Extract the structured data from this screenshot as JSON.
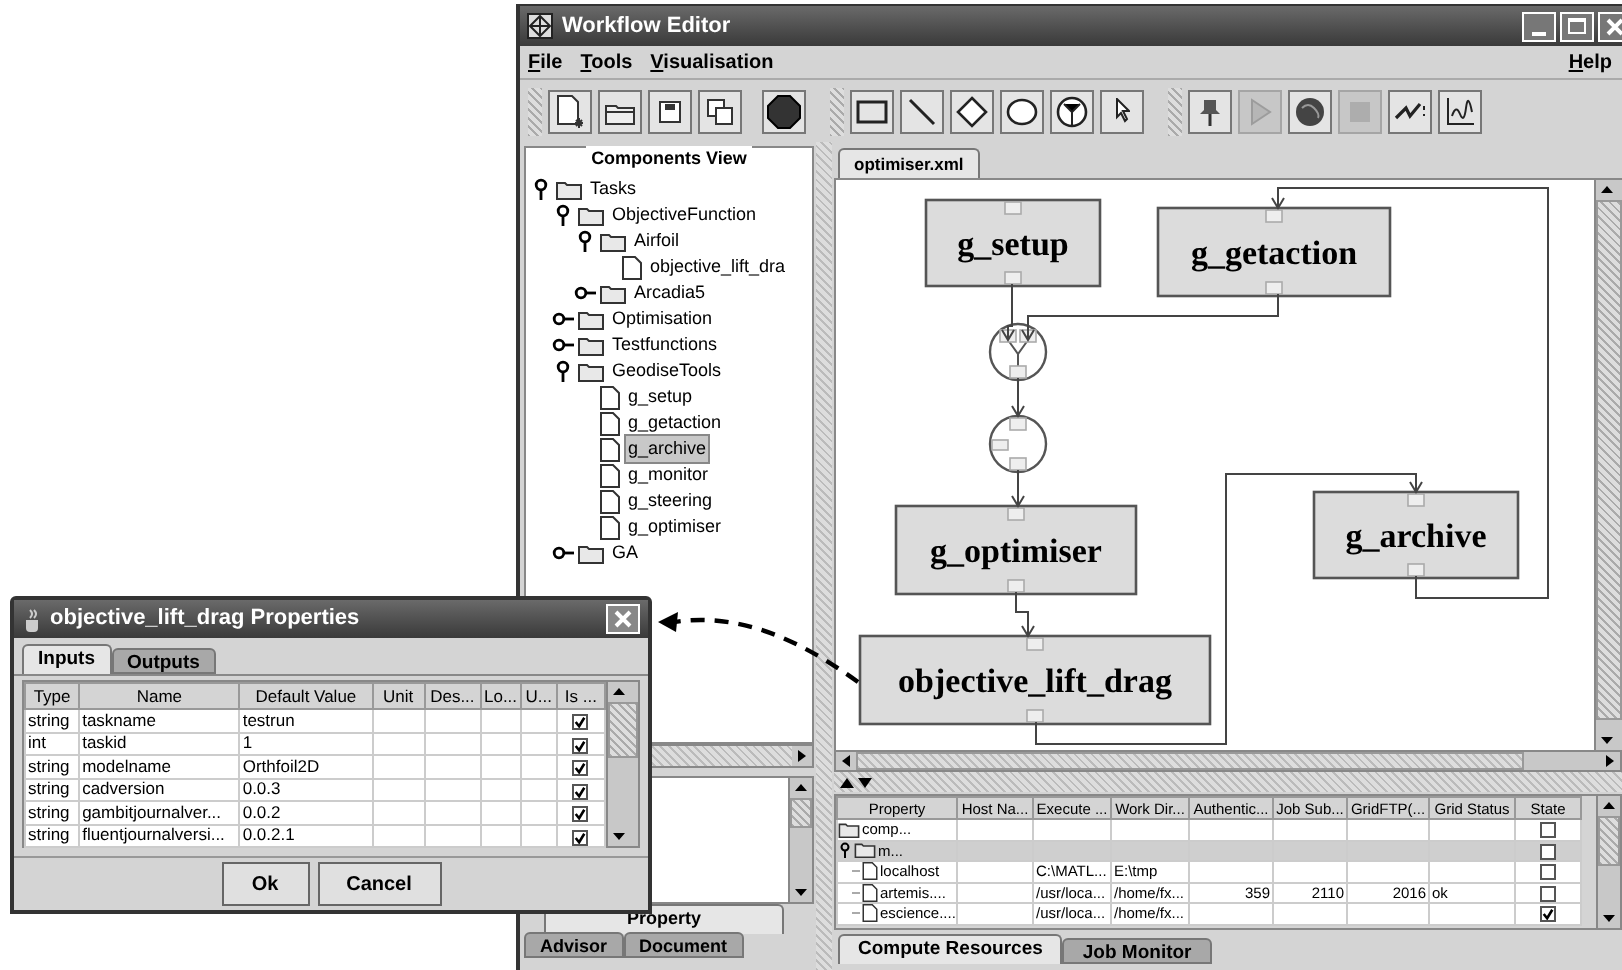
{
  "window": {
    "title": "Workflow Editor"
  },
  "menu": [
    {
      "label": "File"
    },
    {
      "label": "Tools"
    },
    {
      "label": "Visualisation"
    }
  ],
  "help_menu": {
    "label": "Help"
  },
  "toolbar": [
    {
      "disabled": false
    },
    {
      "disabled": false
    },
    {
      "disabled": false
    },
    {
      "disabled": false
    },
    {
      "disabled": false
    },
    {
      "disabled": false
    },
    {
      "disabled": false
    },
    {
      "disabled": false
    },
    {
      "disabled": false
    },
    {
      "disabled": false
    },
    {
      "disabled": false
    },
    {
      "disabled": false
    },
    {
      "disabled": true
    },
    {
      "disabled": false
    },
    {
      "disabled": true
    },
    {
      "disabled": false
    },
    {
      "disabled": false
    }
  ],
  "components_view": {
    "title": "Components View",
    "tree": [
      {
        "label": "Tasks",
        "kind": "folder",
        "expanded": true,
        "selected": false,
        "children": [
          {
            "label": "ObjectiveFunction",
            "kind": "folder",
            "expanded": true,
            "selected": false,
            "children": [
              {
                "label": "Airfoil",
                "kind": "folder",
                "expanded": true,
                "selected": false,
                "children": [
                  {
                    "label": "objective_lift_dra",
                    "kind": "file",
                    "selected": false
                  }
                ]
              },
              {
                "label": "Arcadia5",
                "kind": "folder",
                "expanded": false,
                "selected": false
              }
            ]
          },
          {
            "label": "Optimisation",
            "kind": "folder",
            "expanded": false,
            "selected": false
          },
          {
            "label": "Testfunctions",
            "kind": "folder",
            "expanded": false,
            "selected": false
          },
          {
            "label": "GeodiseTools",
            "kind": "folder",
            "expanded": true,
            "selected": false,
            "children": [
              {
                "label": "g_setup",
                "kind": "file",
                "selected": false
              },
              {
                "label": "g_getaction",
                "kind": "file",
                "selected": false
              },
              {
                "label": "g_archive",
                "kind": "file",
                "selected": true
              },
              {
                "label": "g_monitor",
                "kind": "file",
                "selected": false
              },
              {
                "label": "g_steering",
                "kind": "file",
                "selected": false
              },
              {
                "label": "g_optimiser",
                "kind": "file",
                "selected": false
              }
            ]
          },
          {
            "label": "GA",
            "kind": "folder",
            "expanded": false,
            "selected": false
          }
        ]
      }
    ]
  },
  "left_tabs": [
    {
      "label": "Property",
      "selected": true
    },
    {
      "label": "Advisor",
      "selected": false
    },
    {
      "label": "Document",
      "selected": false
    }
  ],
  "editor_tabs": [
    {
      "label": "optimiser.xml",
      "selected": true
    }
  ],
  "diagram": {
    "nodes": [
      {
        "kind": "task",
        "label": "g_setup"
      },
      {
        "kind": "task",
        "label": "g_getaction"
      },
      {
        "kind": "merge"
      },
      {
        "kind": "junction"
      },
      {
        "kind": "task",
        "label": "g_optimiser"
      },
      {
        "kind": "task",
        "label": "objective_lift_drag"
      },
      {
        "kind": "task",
        "label": "g_archive"
      }
    ]
  },
  "resources": {
    "columns": [
      "Property",
      "Host Na...",
      "Execute ...",
      "Work Dir...",
      "Authentic...",
      "Job Sub...",
      "GridFTP(...",
      "Grid Status",
      "State"
    ],
    "rows": [
      {
        "kind": "folder",
        "expanded": false,
        "selected": false,
        "checked": false,
        "property": "comp..."
      },
      {
        "kind": "folder",
        "expanded": true,
        "selected": true,
        "checked": false,
        "property": "m...",
        "children": [
          {
            "kind": "file",
            "selected": false,
            "checked": false,
            "property": "localhost",
            "execute": "C:\\MATL...",
            "work_dir": "E:\\tmp"
          },
          {
            "kind": "file",
            "selected": false,
            "checked": false,
            "property": "artemis....",
            "execute": "/usr/loca...",
            "work_dir": "/home/fx...",
            "authentication": "359",
            "job_submission": "2110",
            "gridftp": "2016",
            "grid_status": "ok"
          },
          {
            "kind": "file",
            "selected": false,
            "checked": true,
            "property": "escience....",
            "execute": "/usr/loca...",
            "work_dir": "/home/fx..."
          }
        ]
      }
    ]
  },
  "bottom_tabs": [
    {
      "label": "Compute Resources",
      "selected": true
    },
    {
      "label": "Job Monitor",
      "selected": false
    }
  ],
  "dialog": {
    "title": "objective_lift_drag Properties",
    "tabs": [
      {
        "label": "Inputs",
        "selected": true
      },
      {
        "label": "Outputs",
        "selected": false
      }
    ],
    "columns": [
      "Type",
      "Name",
      "Default Value",
      "Unit",
      "Des...",
      "Lo...",
      "U...",
      "Is ..."
    ],
    "rows": [
      {
        "type": "string",
        "name": "taskname",
        "default_value": "testrun",
        "checked": true
      },
      {
        "type": "int",
        "name": "taskid",
        "default_value": "1",
        "checked": true
      },
      {
        "type": "string",
        "name": "modelname",
        "default_value": "Orthfoil2D",
        "checked": true
      },
      {
        "type": "string",
        "name": "cadversion",
        "default_value": "0.0.3",
        "checked": true
      },
      {
        "type": "string",
        "name": "gambitjournalver...",
        "default_value": "0.0.2",
        "checked": true
      },
      {
        "type": "string",
        "name": "fluentjournalversi...",
        "default_value": "0.0.2.1",
        "checked": true
      }
    ],
    "buttons": [
      {
        "label": "Ok"
      },
      {
        "label": "Cancel"
      }
    ]
  }
}
